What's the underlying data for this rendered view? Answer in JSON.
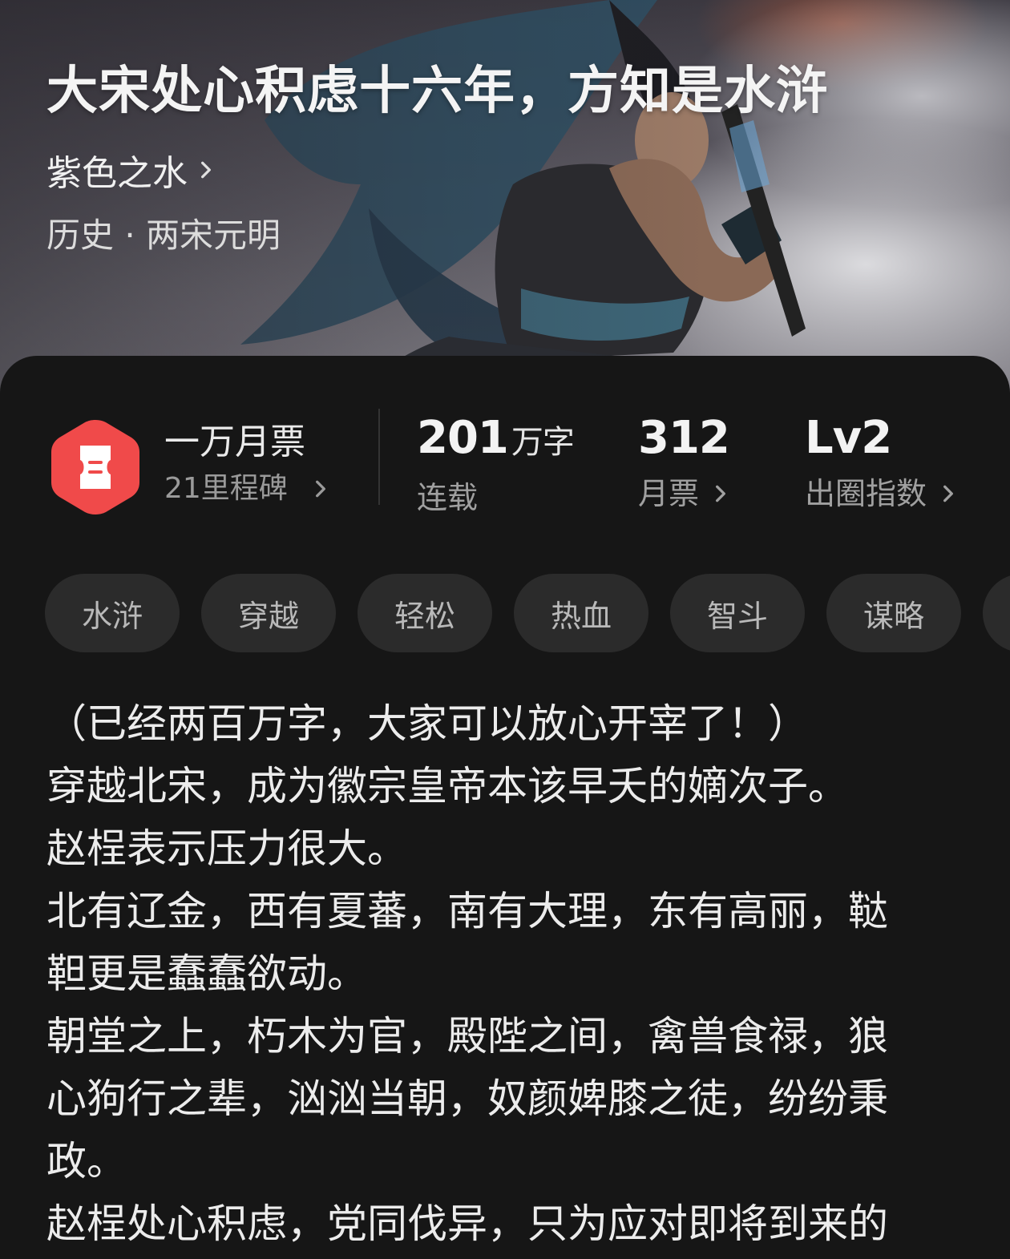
{
  "book": {
    "title": "大宋处心积虑十六年，方知是水浒",
    "author": "紫色之水",
    "genre": "历史 · 两宋元明"
  },
  "milestone": {
    "title": "一万月票",
    "count": "21里程碑"
  },
  "stats": {
    "words": {
      "value": "201",
      "unit": "万字",
      "label": "连载"
    },
    "monthly_tickets": {
      "value": "312",
      "label": "月票"
    },
    "influence": {
      "value": "Lv2",
      "label": "出圈指数"
    }
  },
  "tags": [
    "水浒",
    "穿越",
    "轻松",
    "热血",
    "智斗",
    "谋略",
    ""
  ],
  "synopsis": [
    "（已经两百万字，大家可以放心开宰了！）",
    "穿越北宋，成为徽宗皇帝本该早夭的嫡次子。",
    "赵桯表示压力很大。",
    "北有辽金，西有夏蕃，南有大理，东有高丽，鞑",
    "靼更是蠢蠢欲动。",
    "朝堂之上，朽木为官，殿陛之间，禽兽食禄，狼",
    "心狗行之辈，汹汹当朝，奴颜婢膝之徒，纷纷秉",
    "政。",
    "赵桯处心积虑，党同伐异，只为应对即将到来的"
  ],
  "colors": {
    "badge_red": "#f04a4a",
    "sheet_bg": "#161616",
    "tag_bg": "#2b2b2b"
  }
}
